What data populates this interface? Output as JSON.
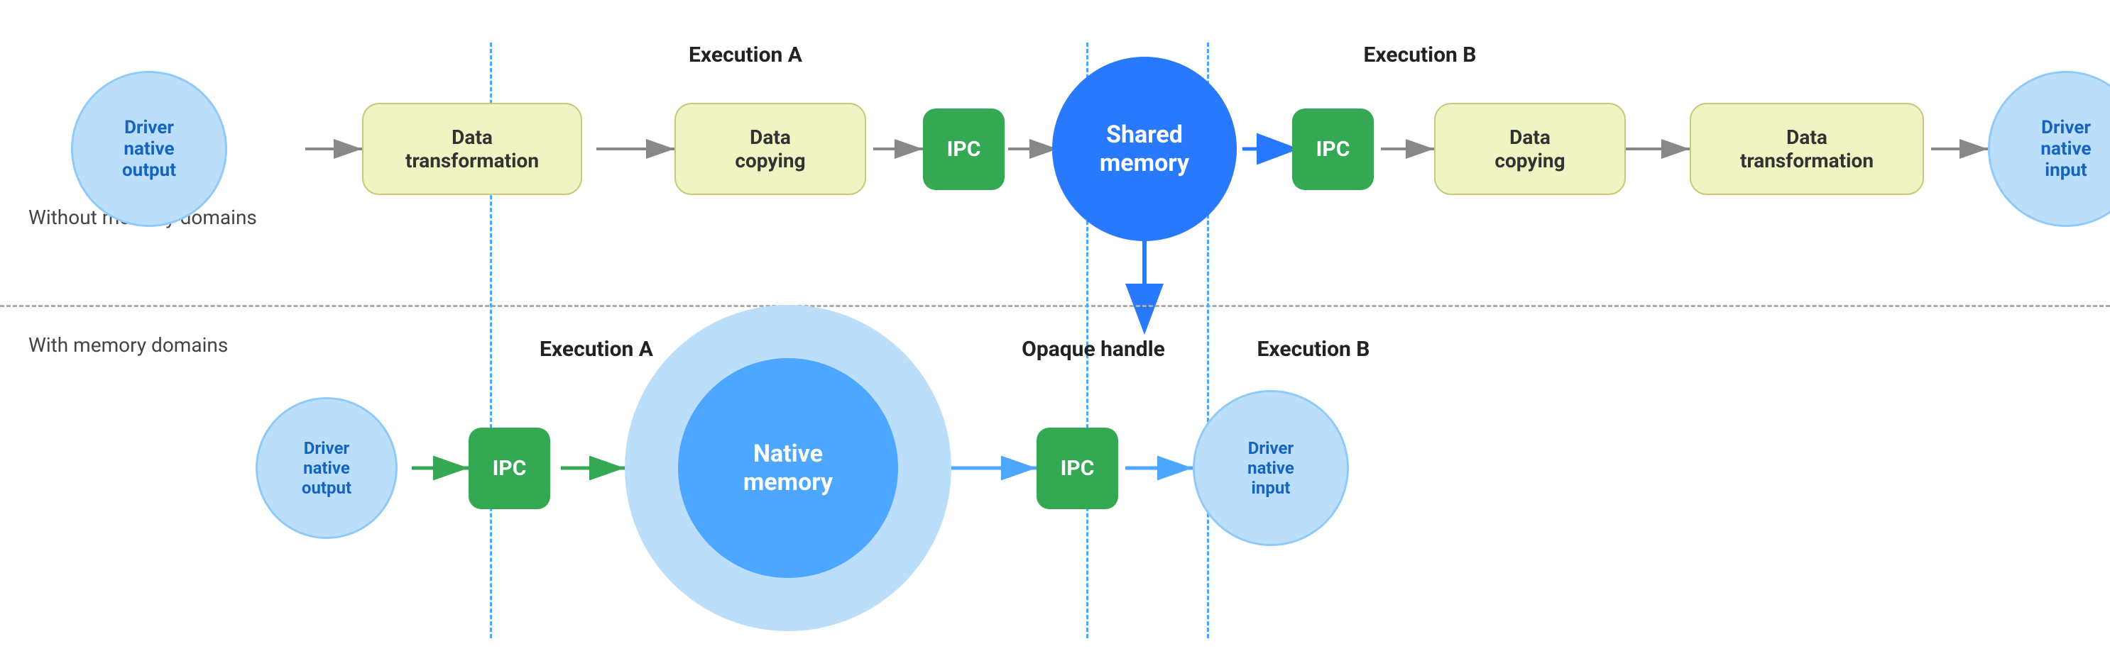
{
  "sections": {
    "without_label": "Without memory domains",
    "with_label": "With memory domains"
  },
  "top_row": {
    "exec_a_label": "Execution A",
    "exec_b_label": "Execution B",
    "driver_native_output": "Driver\nnative\noutput",
    "data_transformation_a": "Data\ntransformation",
    "data_copying_a": "Data\ncopying",
    "ipc_a": "IPC",
    "shared_memory": "Shared\nmemory",
    "ipc_b": "IPC",
    "data_copying_b": "Data\ncopying",
    "data_transformation_b": "Data\ntransformation",
    "driver_native_input": "Driver\nnative\ninput"
  },
  "bottom_row": {
    "exec_a_label": "Execution A",
    "opaque_label": "Opaque handle",
    "exec_b_label": "Execution B",
    "driver_native_output": "Driver\nnative\noutput",
    "ipc_a": "IPC",
    "native_memory": "Native\nmemory",
    "ipc_b": "IPC",
    "driver_native_input": "Driver\nnative\ninput"
  },
  "colors": {
    "yellow_bg": "#f0f4c3",
    "yellow_border": "#c5ca7a",
    "green": "#34a853",
    "light_blue": "#bbdefb",
    "blue": "#2979ff",
    "med_blue": "#4da6ff",
    "text_dark": "#1a1a1a",
    "vline_blue": "#4da6ff",
    "arrow_green": "#34a853",
    "arrow_blue": "#2979ff"
  }
}
